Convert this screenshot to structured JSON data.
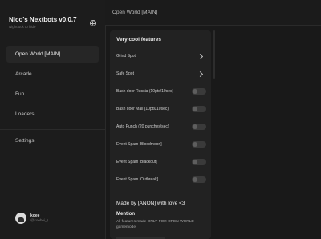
{
  "app": {
    "title": "Nico's Nextbots v0.0.7",
    "subtitle": "Nightfuck to hide"
  },
  "sidebar": {
    "items": [
      {
        "label": "Open World [MAIN]"
      },
      {
        "label": "Arcade"
      },
      {
        "label": "Fun"
      },
      {
        "label": "Loaders"
      },
      {
        "label": "Settings"
      }
    ],
    "user": {
      "name": "koee",
      "handle": "@koeboi_)"
    }
  },
  "header": {
    "title": "Open World [MAIN]"
  },
  "main": {
    "section_title": "Very cool features",
    "rows": [
      {
        "label": "Grind Spot",
        "type": "chevron"
      },
      {
        "label": "Safe Spot",
        "type": "chevron"
      },
      {
        "label": "Bash door Russia (10pts/10sec)",
        "type": "toggle",
        "on": false
      },
      {
        "label": "Bash door Mall (10pts/10sec)",
        "type": "toggle",
        "on": false
      },
      {
        "label": "Auto Punch (20 punches/sec)",
        "type": "toggle",
        "on": false
      },
      {
        "label": "Event Spam [Bloodmoon]",
        "type": "toggle",
        "on": false
      },
      {
        "label": "Event Spam [Blackout]",
        "type": "toggle",
        "on": false
      },
      {
        "label": "Event Spam [Outbreak]",
        "type": "toggle",
        "on": false
      }
    ],
    "footer": "Made by [ANON] with love <3",
    "mention_title": "Mention",
    "mention_text": "All features made ONLY FOR OPEN WORLD gamemode."
  }
}
